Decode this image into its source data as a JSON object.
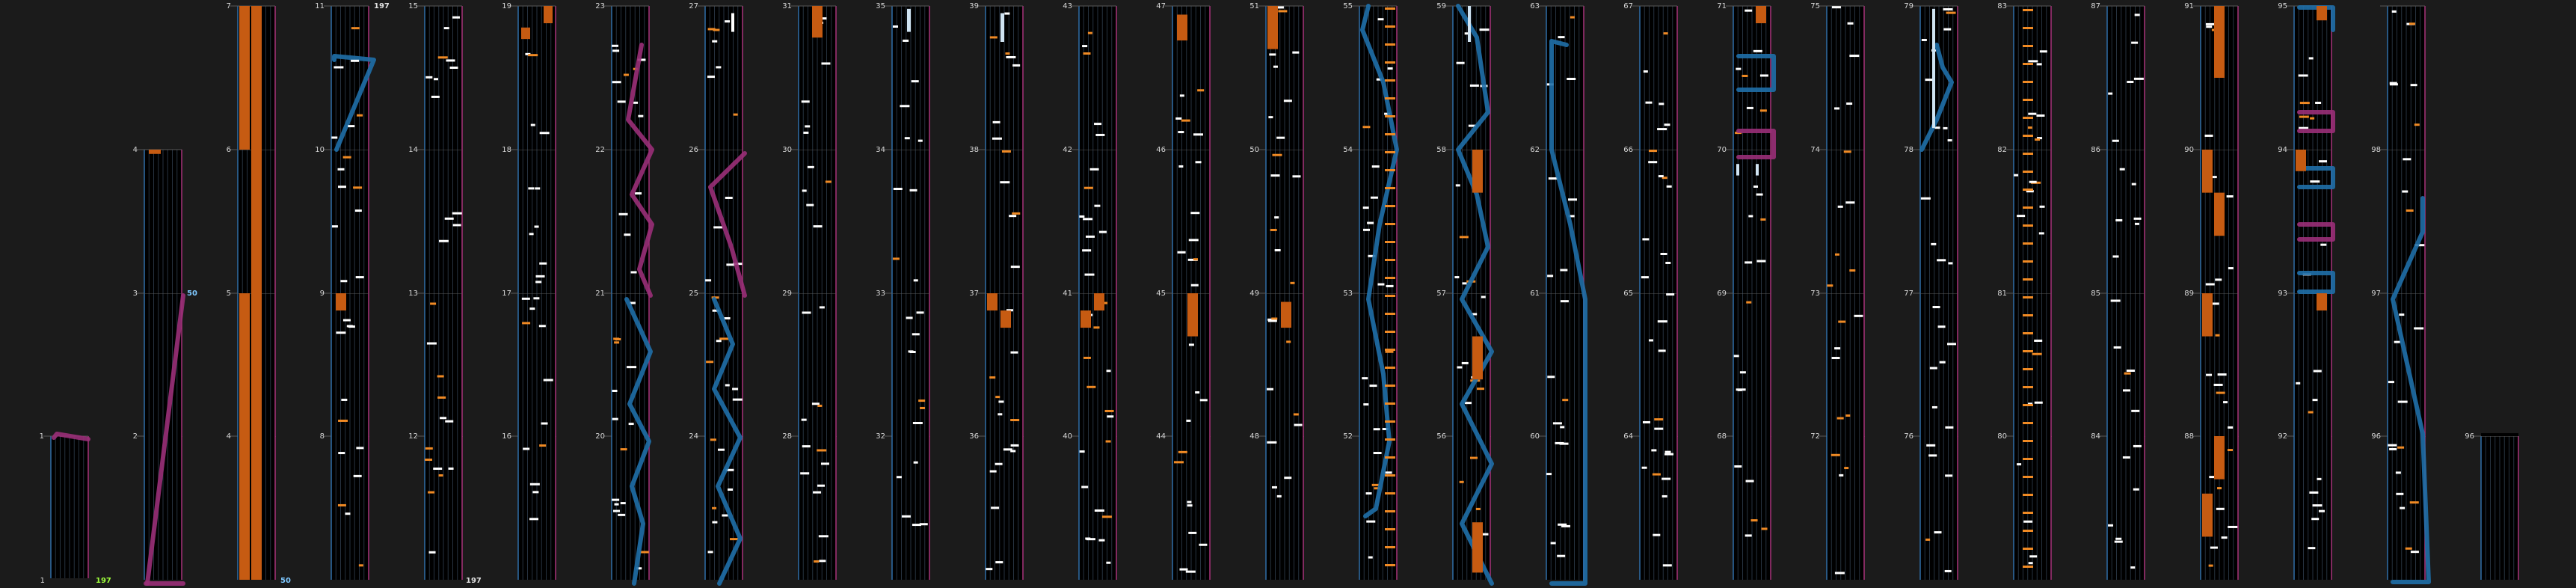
{
  "app": {
    "colors": {
      "background": "#1b1b1b",
      "lane_bg": "#000000",
      "lane_grid": "#26323f",
      "lane_border_left": "#2f6ea8",
      "lane_border_right": "#a8327a",
      "measure_line": "#5a5a5a",
      "note_tap": "#ffffff",
      "note_orange": "#f08a24",
      "hold_orange": "#c65b12",
      "slide_blue": "#1f6fa8",
      "slide_magenta": "#9a2f78",
      "hold_white": "#cfe3f2",
      "combo_green": "#9fff3c",
      "combo_blue": "#7ec8ff",
      "combo_white": "#e0e0e0"
    }
  },
  "chart": {
    "measure_labels": [
      "1",
      "2",
      "3",
      "4",
      "5",
      "6",
      "7",
      "8",
      "9",
      "10",
      "11",
      "12",
      "13",
      "14",
      "15",
      "16",
      "17",
      "18",
      "19",
      "20",
      "21",
      "22",
      "23",
      "24",
      "25",
      "26",
      "27",
      "28",
      "29",
      "30",
      "31",
      "32",
      "33",
      "34",
      "35",
      "36",
      "37",
      "38",
      "39",
      "40",
      "41",
      "42",
      "43",
      "44",
      "45",
      "46",
      "47",
      "48",
      "49",
      "50",
      "51",
      "52",
      "53",
      "54",
      "55",
      "56",
      "57",
      "58",
      "59",
      "60",
      "61",
      "62",
      "63",
      "64",
      "65",
      "66",
      "67",
      "68",
      "69",
      "70",
      "71",
      "72",
      "73",
      "74",
      "75",
      "76",
      "77",
      "78",
      "79",
      "80",
      "81",
      "82",
      "83",
      "84",
      "85",
      "86",
      "87",
      "88",
      "89",
      "90",
      "91",
      "92",
      "93",
      "94",
      "95",
      "96",
      "97",
      "98"
    ],
    "combo_labels": [
      {
        "column": 0,
        "text": "197",
        "color": "combo_green"
      },
      {
        "column": 1,
        "text": "50",
        "color": "combo_blue"
      },
      {
        "column": 2,
        "text": "50",
        "color": "combo_blue"
      },
      {
        "column": 3,
        "text": "197",
        "color": "combo_white"
      },
      {
        "column": 4,
        "text": "197",
        "color": "combo_white"
      }
    ]
  }
}
